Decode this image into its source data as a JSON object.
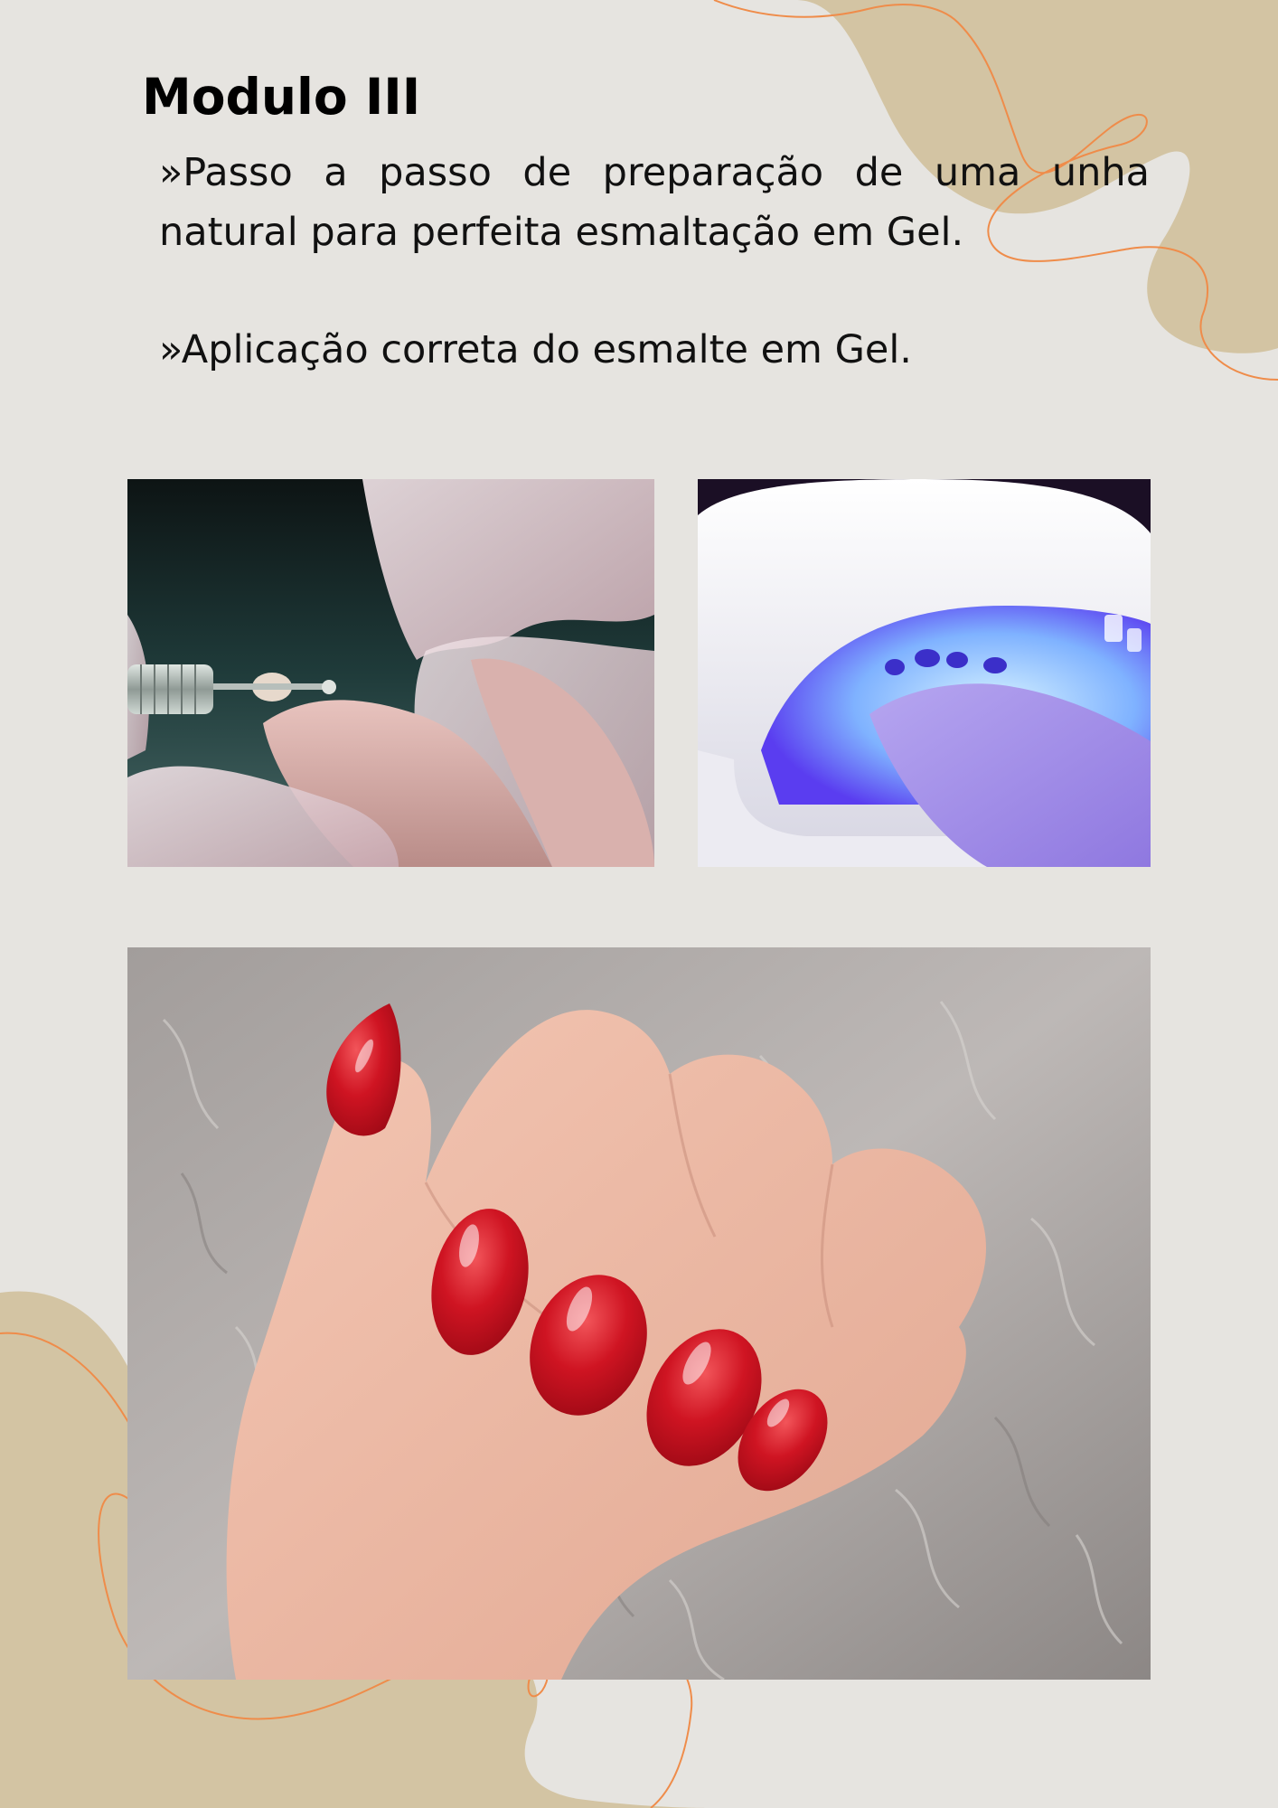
{
  "page": {
    "title": "Modulo III",
    "paragraphs": [
      "»Passo a passo de preparação de uma unha natural para perfeita esmaltação em Gel.",
      "»Aplicação correta do esmalte em Gel."
    ]
  },
  "photos": [
    {
      "subject": "nail-drill-preparation"
    },
    {
      "subject": "uv-led-lamp-curing"
    },
    {
      "subject": "red-gel-nails-on-fur"
    }
  ],
  "colors": {
    "background": "#e6e4e0",
    "blob": "#d3c4a3",
    "accent_line": "#ef8c4a",
    "text": "#000000"
  }
}
